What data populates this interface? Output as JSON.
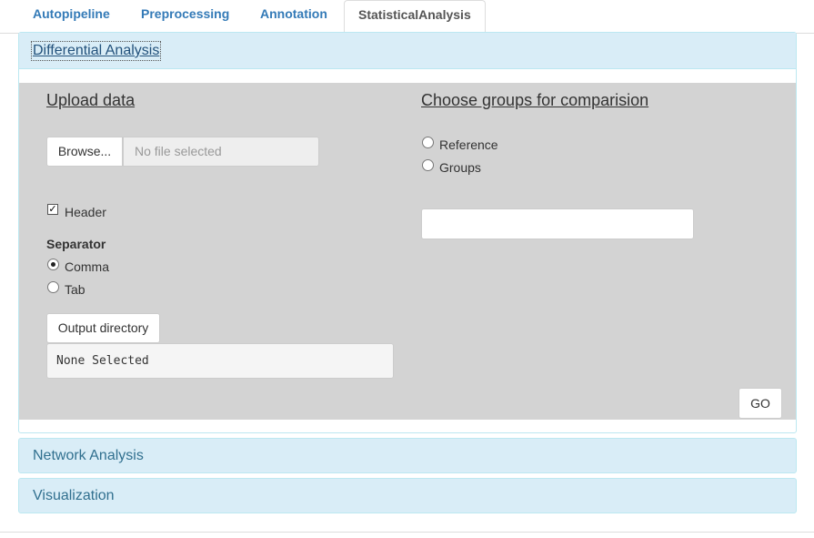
{
  "tabs": [
    {
      "label": "Autopipeline"
    },
    {
      "label": "Preprocessing"
    },
    {
      "label": "Annotation"
    },
    {
      "label": "StatisticalAnalysis"
    }
  ],
  "panels": {
    "differential": {
      "title": "Differential Analysis"
    },
    "network": {
      "title": "Network Analysis"
    },
    "visualization": {
      "title": "Visualization"
    }
  },
  "upload": {
    "title": "Upload data",
    "browse_label": "Browse...",
    "file_placeholder": "No file selected",
    "header_label": "Header",
    "header_checked": true,
    "separator_label": "Separator",
    "separator_options": [
      {
        "label": "Comma",
        "selected": true
      },
      {
        "label": "Tab",
        "selected": false
      }
    ],
    "output_dir_label": "Output directory",
    "output_dir_value": "None Selected"
  },
  "groups": {
    "title": "Choose groups for comparision",
    "options": [
      {
        "label": "Reference",
        "selected": false
      },
      {
        "label": "Groups",
        "selected": false
      }
    ],
    "text_value": ""
  },
  "go_label": "GO"
}
